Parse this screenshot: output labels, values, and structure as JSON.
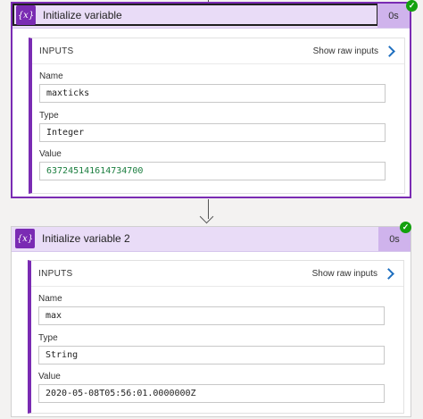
{
  "cards": [
    {
      "title": "Initialize variable",
      "icon": "{x}",
      "duration": "0s",
      "status": "succeeded",
      "inputs_label": "INPUTS",
      "raw_link": "Show raw inputs",
      "fields": [
        {
          "label": "Name",
          "value": "maxticks"
        },
        {
          "label": "Type",
          "value": "Integer"
        },
        {
          "label": "Value",
          "value": "637245141614734700"
        }
      ]
    },
    {
      "title": "Initialize variable 2",
      "icon": "{x}",
      "duration": "0s",
      "status": "succeeded",
      "inputs_label": "INPUTS",
      "raw_link": "Show raw inputs",
      "fields": [
        {
          "label": "Name",
          "value": "max"
        },
        {
          "label": "Type",
          "value": "String"
        },
        {
          "label": "Value",
          "value": "2020-05-08T05:56:01.0000000Z"
        }
      ]
    }
  ],
  "colors": {
    "accent": "#7a2bb3",
    "header_bg": "#e9dcf7",
    "success": "#13a10e"
  }
}
